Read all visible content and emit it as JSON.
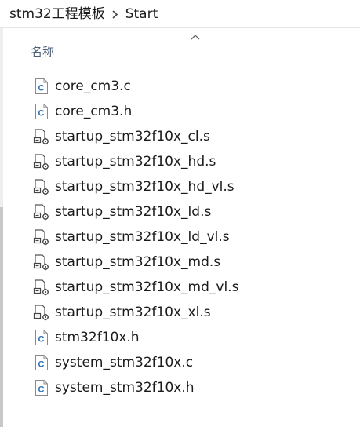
{
  "breadcrumb": {
    "items": [
      "stm32工程模板",
      "Start"
    ]
  },
  "header": {
    "name_column": "名称"
  },
  "files": [
    {
      "name": "core_cm3.c",
      "icon": "c-source-file-icon"
    },
    {
      "name": "core_cm3.h",
      "icon": "c-source-file-icon"
    },
    {
      "name": "startup_stm32f10x_cl.s",
      "icon": "assembly-file-icon"
    },
    {
      "name": "startup_stm32f10x_hd.s",
      "icon": "assembly-file-icon"
    },
    {
      "name": "startup_stm32f10x_hd_vl.s",
      "icon": "assembly-file-icon"
    },
    {
      "name": "startup_stm32f10x_ld.s",
      "icon": "assembly-file-icon"
    },
    {
      "name": "startup_stm32f10x_ld_vl.s",
      "icon": "assembly-file-icon"
    },
    {
      "name": "startup_stm32f10x_md.s",
      "icon": "assembly-file-icon"
    },
    {
      "name": "startup_stm32f10x_md_vl.s",
      "icon": "assembly-file-icon"
    },
    {
      "name": "startup_stm32f10x_xl.s",
      "icon": "assembly-file-icon"
    },
    {
      "name": "stm32f10x.h",
      "icon": "c-source-file-icon"
    },
    {
      "name": "system_stm32f10x.c",
      "icon": "c-source-file-icon"
    },
    {
      "name": "system_stm32f10x.h",
      "icon": "c-source-file-icon"
    }
  ],
  "colors": {
    "header_text": "#4c607a",
    "c_icon": "#2a6fb0"
  }
}
